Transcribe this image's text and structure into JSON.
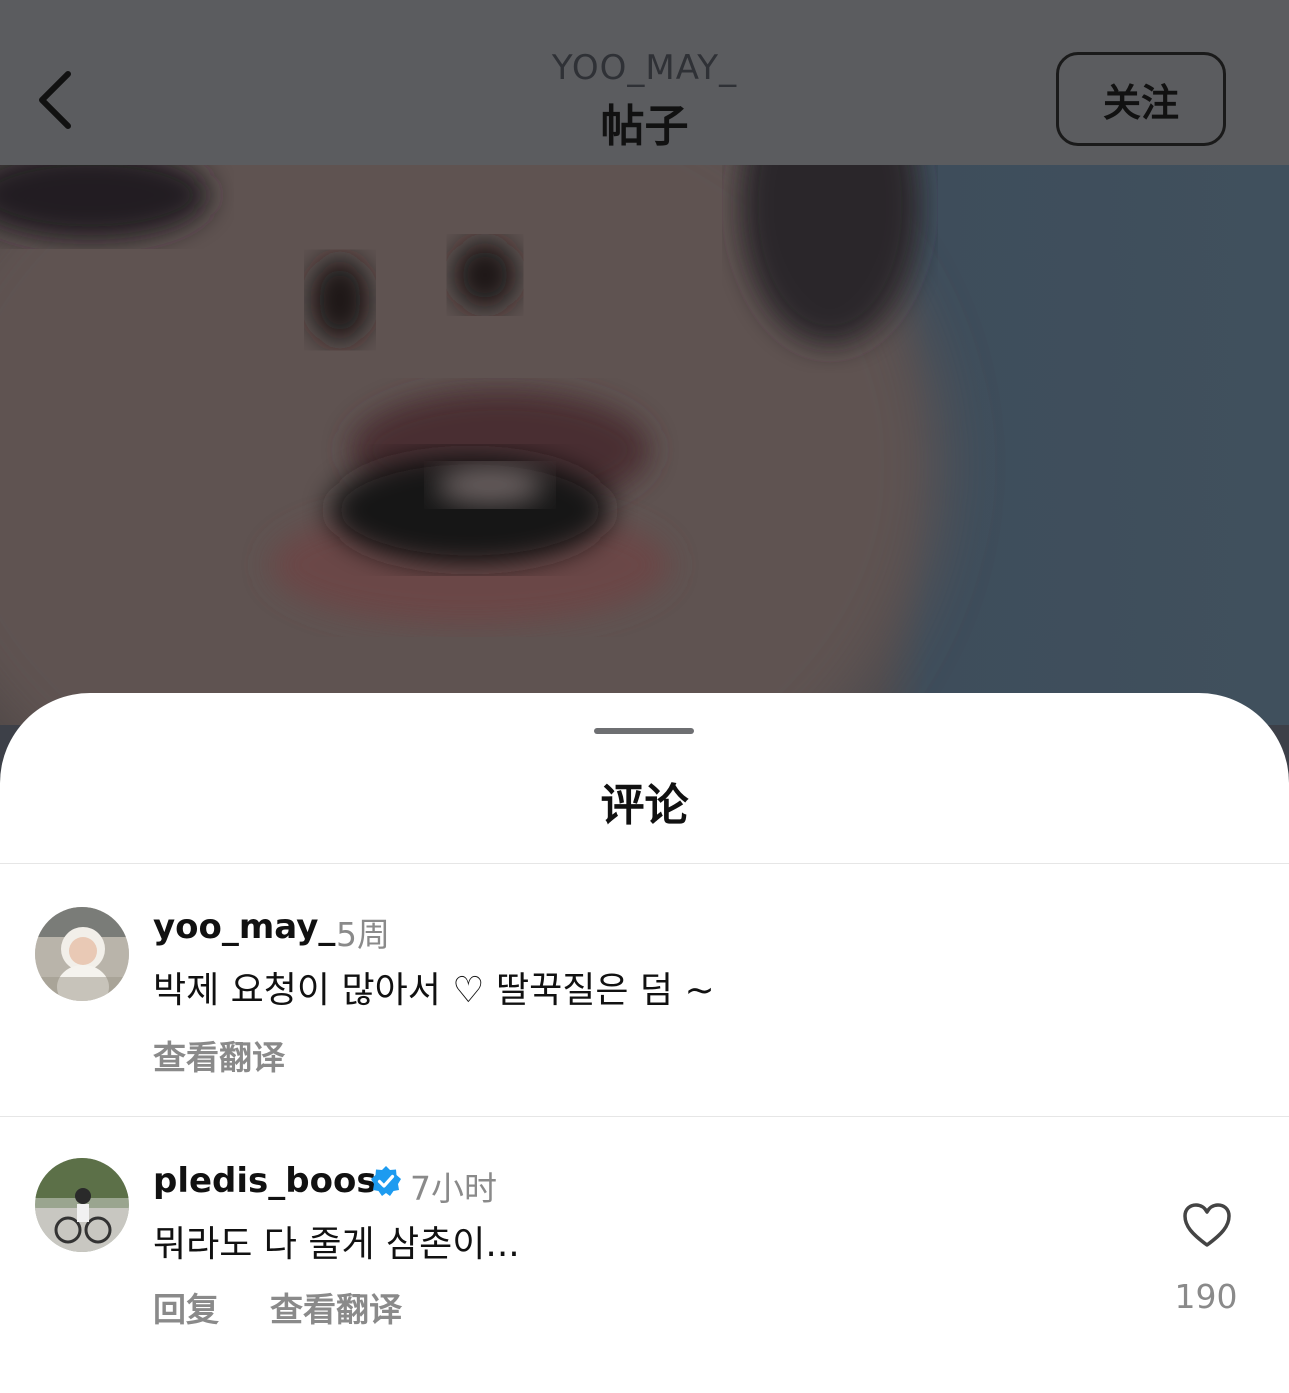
{
  "header": {
    "username": "YOO_MAY_",
    "title": "帖子",
    "follow_label": "关注"
  },
  "sheet": {
    "title": "评论"
  },
  "comments": [
    {
      "username": "yoo_may_",
      "time": "5周",
      "text": "박제 요청이 많아서 ♡ 딸꾹질은 덤 ~",
      "translate_label": "查看翻译"
    },
    {
      "username": "pledis_boos",
      "verified": true,
      "time": "7小时",
      "text": "뭐라도 다 줄게 삼촌이...",
      "reply_label": "回复",
      "translate_label": "查看翻译",
      "like_count": "190"
    }
  ],
  "colors": {
    "verified": "#1d9bf0",
    "secondary_text": "#8a8a8a"
  }
}
